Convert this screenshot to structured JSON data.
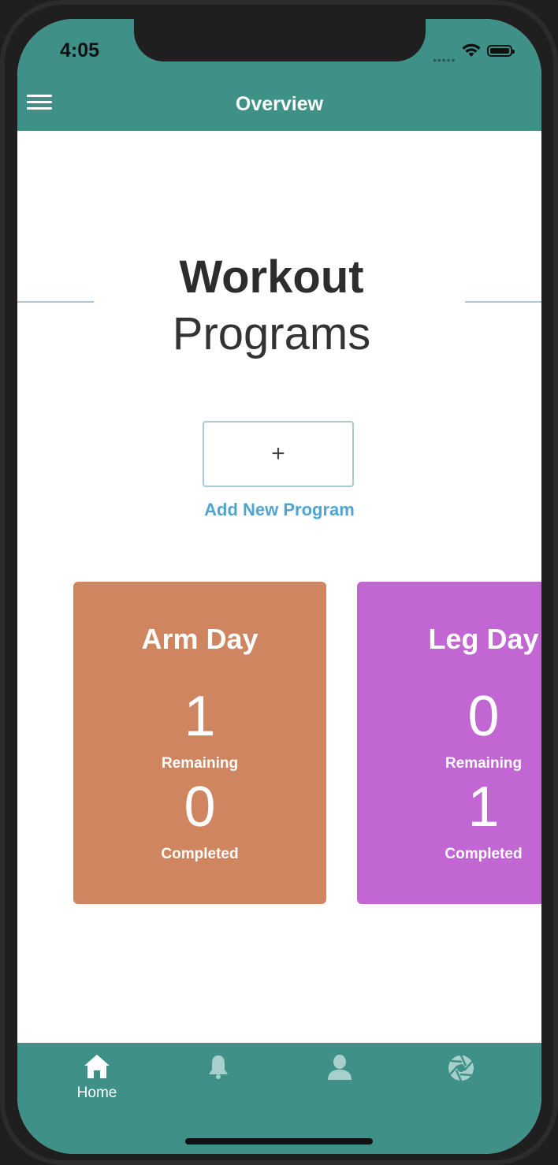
{
  "status_bar": {
    "time": "4:05"
  },
  "nav": {
    "title": "Overview"
  },
  "heading": {
    "line1": "Workout",
    "line2": "Programs"
  },
  "add_program": {
    "symbol": "+",
    "label": "Add New Program"
  },
  "cards": [
    {
      "title": "Arm Day",
      "remaining_count": "1",
      "remaining_label": "Remaining",
      "completed_count": "0",
      "completed_label": "Completed",
      "color": "#cf8660"
    },
    {
      "title": "Leg Day",
      "remaining_count": "0",
      "remaining_label": "Remaining",
      "completed_count": "1",
      "completed_label": "Completed",
      "color": "#c266d4"
    }
  ],
  "tab_bar": {
    "tabs": [
      {
        "icon": "home-icon",
        "label": "Home",
        "active": true
      },
      {
        "icon": "bell-icon",
        "label": "",
        "active": false
      },
      {
        "icon": "person-icon",
        "label": "",
        "active": false
      },
      {
        "icon": "aperture-icon",
        "label": "",
        "active": false
      }
    ]
  },
  "colors": {
    "primary": "#3f9087",
    "inactive_icon": "#a7d0cc",
    "link": "#4ea5d1"
  }
}
